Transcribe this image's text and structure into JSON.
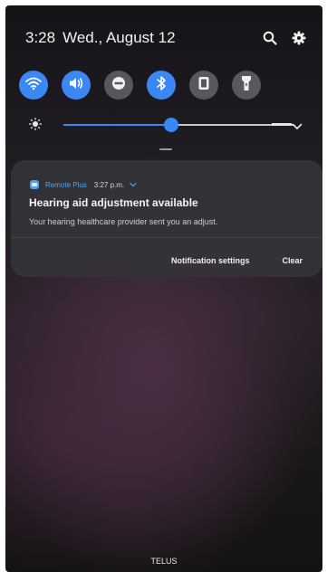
{
  "status_bar": {
    "time": "3:28",
    "date": "Wed., August 12"
  },
  "quick_settings": {
    "toggles": [
      {
        "icon": "wifi-icon",
        "state": "on"
      },
      {
        "icon": "sound-icon",
        "state": "on"
      },
      {
        "icon": "do-not-disturb-icon",
        "state": "off"
      },
      {
        "icon": "bluetooth-icon",
        "state": "on"
      },
      {
        "icon": "rotation-lock-icon",
        "state": "off"
      },
      {
        "icon": "flashlight-icon",
        "state": "off"
      }
    ],
    "brightness_level": 0.47,
    "accent_color": "#3b88f5"
  },
  "notification": {
    "app_name": "Remote Plus",
    "time": "3:27 p.m.",
    "title": "Hearing aid adjustment available",
    "body": "Your hearing healthcare provider sent you an adjust.",
    "actions": {
      "settings_label": "Notification settings",
      "clear_label": "Clear"
    }
  },
  "carrier": "TELUS"
}
